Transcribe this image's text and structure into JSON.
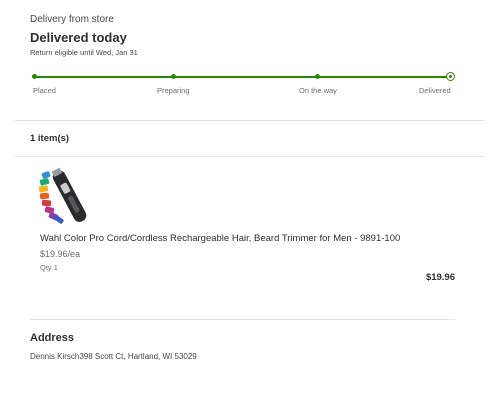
{
  "order": {
    "fulfillment_type": "Delivery from store",
    "status_title": "Delivered today",
    "return_note": "Return eligible until Wed, Jan 31"
  },
  "tracker": {
    "steps": [
      "Placed",
      "Preparing",
      "On the way",
      "Delivered"
    ],
    "current_step": 4,
    "progress": 1.0,
    "accent_color": "#2a8703"
  },
  "items": {
    "count_label": "1 item(s)",
    "list": [
      {
        "name": "Wahl Color Pro Cord/Cordless Rechargeable Hair, Beard Trimmer for Men - 9891-100",
        "unit_price": "$19.96/ea",
        "qty": "Qty 1",
        "total": "$19.96",
        "image_icon": "hair-trimmer-with-colored-guards"
      }
    ]
  },
  "address": {
    "heading": "Address",
    "text": "Dennis Kirsch398 Scott Ct, Hartland, WI 53029"
  }
}
